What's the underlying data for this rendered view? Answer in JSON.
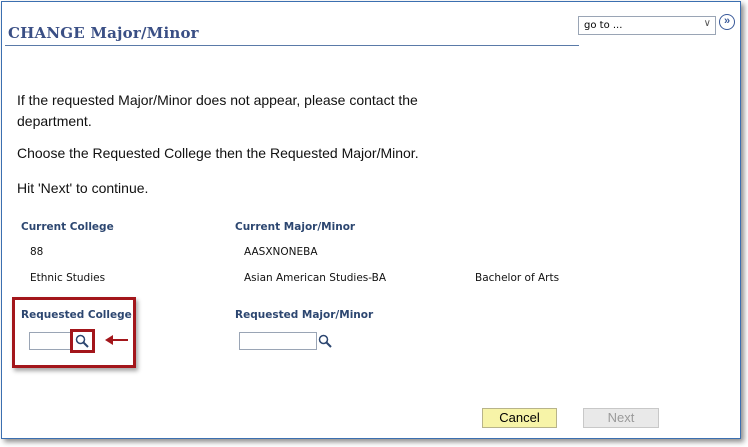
{
  "page": {
    "title": "CHANGE Major/Minor",
    "goto_label": "go to ...",
    "goto_button_icon": "double-chevron-right-icon"
  },
  "instructions": {
    "line1a": "If the requested Major/Minor does not appear, please contact the",
    "line1b": "department.",
    "line2": "Choose the Requested College then the Requested Major/Minor.",
    "line3": "Hit 'Next' to continue."
  },
  "current": {
    "college_label": "Current College",
    "major_label": "Current Major/Minor",
    "college_code": "88",
    "college_name": "Ethnic Studies",
    "major_code": "AASXNONEBA",
    "major_name": "Asian American Studies-BA",
    "degree": "Bachelor of Arts"
  },
  "requested": {
    "college_label": "Requested College",
    "major_label": "Requested Major/Minor",
    "college_value": "",
    "major_value": ""
  },
  "buttons": {
    "cancel": "Cancel",
    "next": "Next"
  },
  "colors": {
    "title": "#3a4f85",
    "label": "#2c4670",
    "highlight": "#a3161b",
    "cancel_bg": "#f7f4a8"
  }
}
